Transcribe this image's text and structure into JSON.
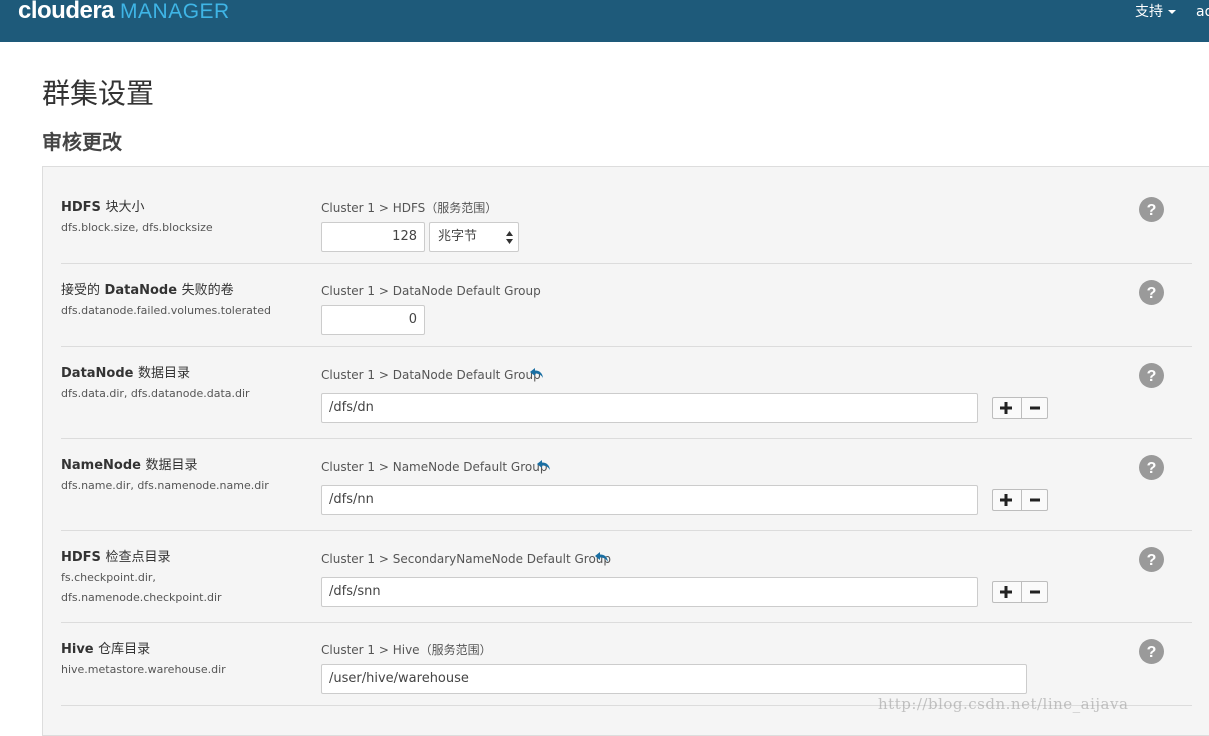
{
  "header": {
    "brand_main": "cloudera",
    "brand_sub": "MANAGER",
    "support_label": "支持",
    "user_label": "ad"
  },
  "page": {
    "title": "群集设置",
    "section": "审核更改"
  },
  "rows": [
    {
      "label_strong": "HDFS",
      "label_cn": "块大小",
      "key": "dfs.block.size, dfs.blocksize",
      "scope": "Cluster 1 > HDFS（服务范围）",
      "value": "128",
      "unit": "兆字节"
    },
    {
      "label_cn_pre": "接受的",
      "label_strong": "DataNode",
      "label_cn": "失败的卷",
      "key": "dfs.datanode.failed.volumes.tolerated",
      "scope": "Cluster 1 > DataNode Default Group",
      "value": "0"
    },
    {
      "label_strong": "DataNode",
      "label_cn": "数据目录",
      "key": "dfs.data.dir, dfs.datanode.data.dir",
      "scope": "Cluster 1 > DataNode Default Group",
      "value": "/dfs/dn"
    },
    {
      "label_strong": "NameNode",
      "label_cn": "数据目录",
      "key": "dfs.name.dir, dfs.namenode.name.dir",
      "scope": "Cluster 1 > NameNode Default Group",
      "value": "/dfs/nn"
    },
    {
      "label_strong": "HDFS",
      "label_cn": "检查点目录",
      "key": "fs.checkpoint.dir,",
      "key2": "dfs.namenode.checkpoint.dir",
      "scope": "Cluster 1 > SecondaryNameNode Default Group",
      "value": "/dfs/snn"
    },
    {
      "label_strong": "Hive",
      "label_cn": "仓库目录",
      "key": "hive.metastore.warehouse.dir",
      "scope": "Cluster 1 > Hive（服务范围）",
      "value": "/user/hive/warehouse"
    }
  ],
  "watermark": "http://blog.csdn.net/line_aijava",
  "colors": {
    "topbar": "#1e5a7a",
    "brand_sub": "#3fb5e6",
    "undo_icon": "#1a6fa3",
    "help_icon": "#9a9a9a"
  },
  "icons": {
    "help": "question-circle-icon",
    "undo": "undo-arrow-icon",
    "add": "plus-icon",
    "remove": "minus-icon"
  }
}
